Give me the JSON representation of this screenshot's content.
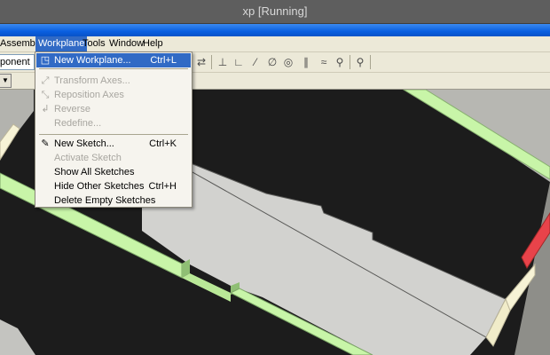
{
  "window": {
    "title": "xp [Running]"
  },
  "menubar": {
    "items": [
      "Assembly",
      "Workplane",
      "Tools",
      "Window",
      "Help"
    ],
    "active": "Workplane"
  },
  "toolbar": {
    "component_combo": "ponent",
    "second_combo_arrow": "▼"
  },
  "workplane_menu": {
    "items": [
      {
        "label": "New Workplane...",
        "shortcut": "Ctrl+L",
        "icon": "new-workplane-icon",
        "enabled": true,
        "selected": true
      },
      {
        "label": "Transform Axes...",
        "shortcut": "",
        "icon": "transform-axes-icon",
        "enabled": false
      },
      {
        "label": "Reposition Axes",
        "shortcut": "",
        "icon": "reposition-axes-icon",
        "enabled": false
      },
      {
        "label": "Reverse",
        "shortcut": "",
        "icon": "reverse-icon",
        "enabled": false
      },
      {
        "label": "Redefine...",
        "shortcut": "",
        "icon": "",
        "enabled": false
      },
      {
        "label": "New Sketch...",
        "shortcut": "Ctrl+K",
        "icon": "new-sketch-icon",
        "enabled": true
      },
      {
        "label": "Activate Sketch",
        "shortcut": "",
        "icon": "",
        "enabled": false
      },
      {
        "label": "Show All Sketches",
        "shortcut": "",
        "icon": "",
        "enabled": true
      },
      {
        "label": "Hide Other Sketches",
        "shortcut": "Ctrl+H",
        "icon": "",
        "enabled": true
      },
      {
        "label": "Delete Empty Sketches",
        "shortcut": "",
        "icon": "",
        "enabled": true
      }
    ]
  },
  "colors": {
    "menu_highlight": "#316ac5",
    "xp_blue": "#0a5fe0",
    "edge_green": "#c8f5a8",
    "edge_cream": "#f7f3d6",
    "edge_red": "#e8434a",
    "face_gray": "#cfcfcb",
    "face_black": "#1c1c1c"
  }
}
